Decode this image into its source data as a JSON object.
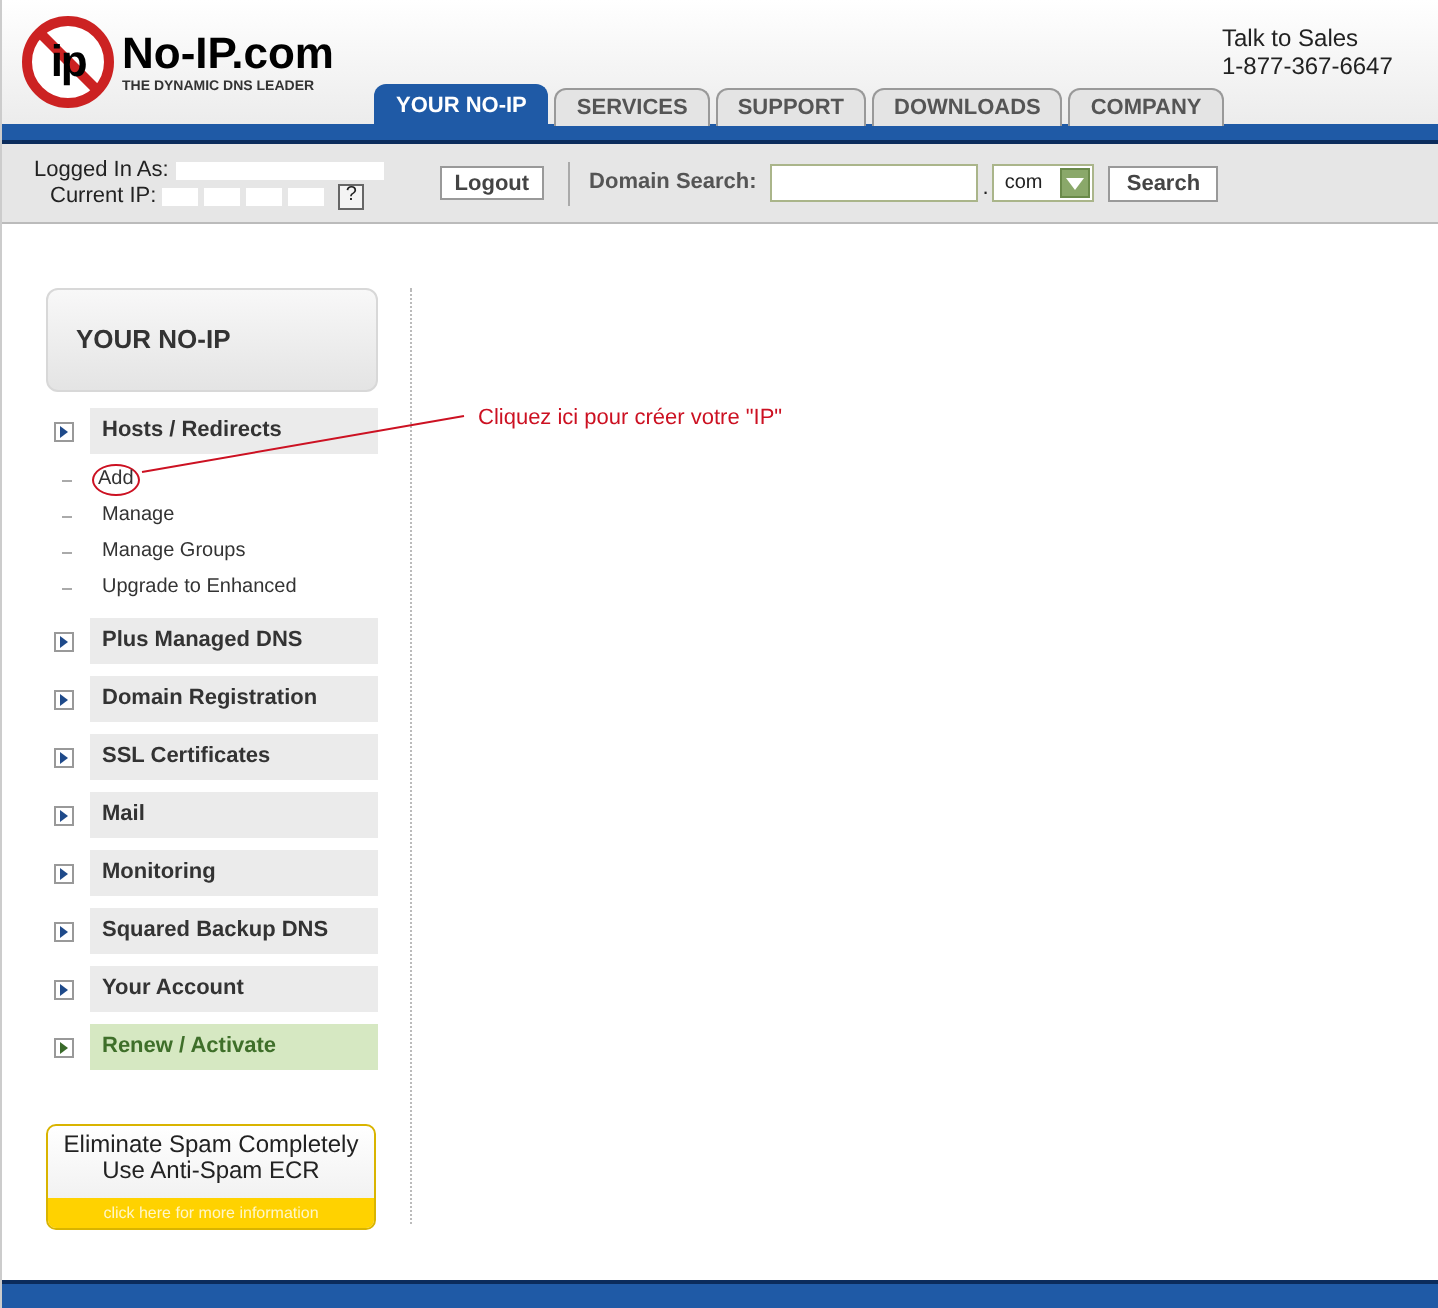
{
  "logo": {
    "mark": "ip",
    "name": "No-IP.com",
    "tagline": "THE DYNAMIC DNS LEADER"
  },
  "sales": {
    "title": "Talk to Sales",
    "phone": "1-877-367-6647"
  },
  "tabs": [
    {
      "label": "YOUR NO-IP",
      "selected": true
    },
    {
      "label": "SERVICES",
      "selected": false
    },
    {
      "label": "SUPPORT",
      "selected": false
    },
    {
      "label": "DOWNLOADS",
      "selected": false
    },
    {
      "label": "COMPANY",
      "selected": false
    }
  ],
  "toolbar": {
    "logged_in_label": "Logged In As:",
    "current_ip_label": "Current IP:",
    "help": "?",
    "logout": "Logout",
    "domain_search_label": "Domain Search:",
    "dot": ".",
    "tld": "com",
    "search_button": "Search"
  },
  "sidebar": {
    "title": "YOUR NO-IP",
    "sections": [
      {
        "label": "Hosts / Redirects",
        "kind": "normal",
        "children": [
          {
            "label": "Add",
            "circled": true
          },
          {
            "label": "Manage",
            "circled": false
          },
          {
            "label": "Manage Groups",
            "circled": false
          },
          {
            "label": "Upgrade to Enhanced",
            "circled": false
          }
        ]
      },
      {
        "label": "Plus Managed DNS",
        "kind": "normal"
      },
      {
        "label": "Domain Registration",
        "kind": "normal"
      },
      {
        "label": "SSL Certificates",
        "kind": "normal"
      },
      {
        "label": "Mail",
        "kind": "normal"
      },
      {
        "label": "Monitoring",
        "kind": "normal"
      },
      {
        "label": "Squared Backup DNS",
        "kind": "normal"
      },
      {
        "label": "Your Account",
        "kind": "normal"
      },
      {
        "label": "Renew / Activate",
        "kind": "renew"
      }
    ],
    "ad": {
      "line1": "Eliminate Spam Completely",
      "line2": "Use Anti-Spam ECR",
      "link": "click here for more information"
    }
  },
  "annotation": {
    "text": "Cliquez ici pour créer votre \"IP\""
  }
}
